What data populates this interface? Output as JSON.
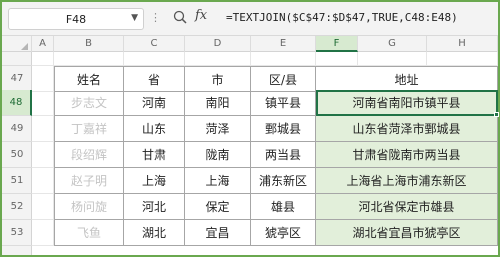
{
  "name_box": "F48",
  "formula": "=TEXTJOIN($C$47:$D$47,TRUE,C48:E48)",
  "columns": [
    "A",
    "B",
    "C",
    "D",
    "E",
    "F",
    "G",
    "H"
  ],
  "rows": [
    "47",
    "48",
    "49",
    "50",
    "51",
    "52",
    "53"
  ],
  "table": {
    "headers": [
      "姓名",
      "省",
      "市",
      "区/县",
      "地址"
    ],
    "rows": [
      {
        "name": "步志文",
        "province": "河南",
        "city": "南阳",
        "district": "镇平县",
        "address": "河南省南阳市镇平县"
      },
      {
        "name": "丁嘉祥",
        "province": "山东",
        "city": "菏泽",
        "district": "鄄城县",
        "address": "山东省菏泽市鄄城县"
      },
      {
        "name": "段绍辉",
        "province": "甘肃",
        "city": "陇南",
        "district": "两当县",
        "address": "甘肃省陇南市两当县"
      },
      {
        "name": "赵子明",
        "province": "上海",
        "city": "上海",
        "district": "浦东新区",
        "address": "上海省上海市浦东新区"
      },
      {
        "name": "杨问旋",
        "province": "河北",
        "city": "保定",
        "district": "雄县",
        "address": "河北省保定市雄县"
      },
      {
        "name": "飞鱼",
        "province": "湖北",
        "city": "宜昌",
        "district": "猇亭区",
        "address": "湖北省宜昌市猇亭区"
      }
    ]
  },
  "colors": {
    "accent": "#217346",
    "address_fill": "#e2efda",
    "frame": "#6aa84f"
  }
}
